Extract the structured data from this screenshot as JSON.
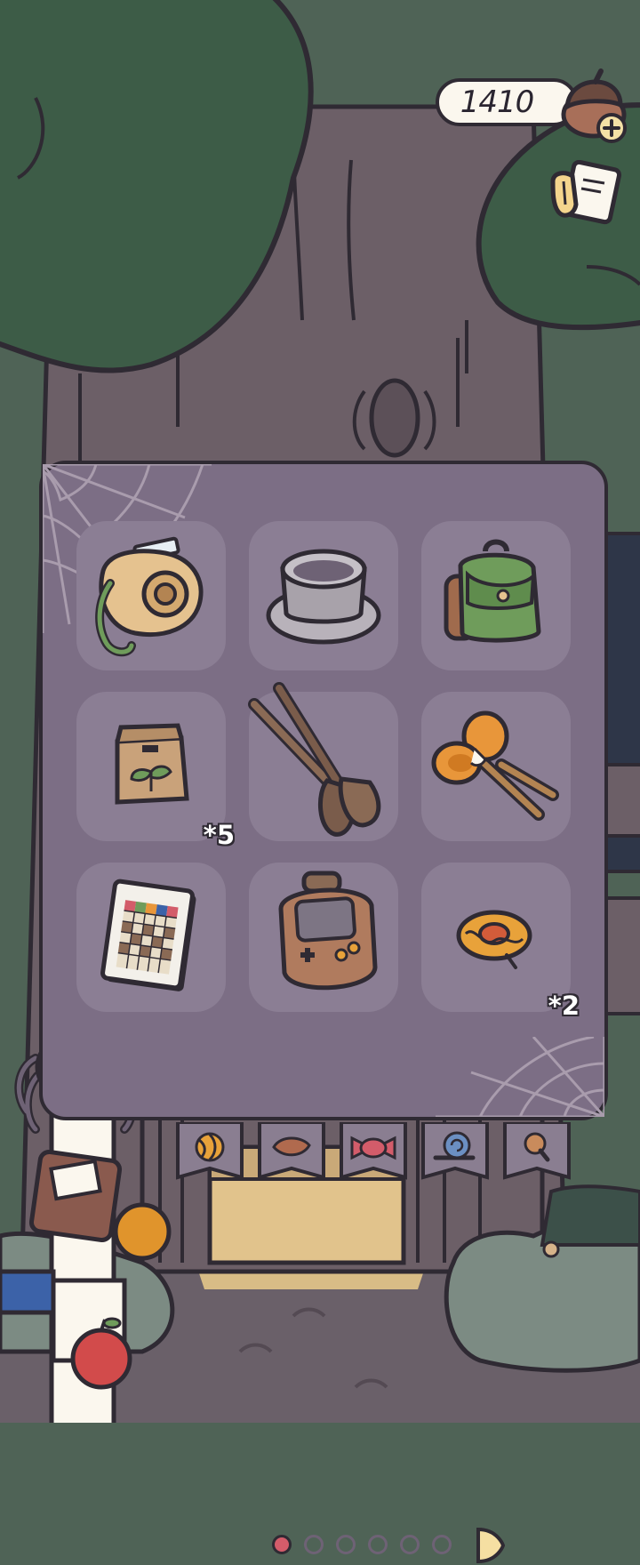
{
  "currency": {
    "amount": "1410",
    "icon": "acorn-plus-icon"
  },
  "header": {
    "note_icon": "hand-note-icon"
  },
  "inventory": {
    "items": [
      {
        "name": "instant-camera",
        "icon": "camera-icon",
        "count": ""
      },
      {
        "name": "teacup",
        "icon": "teacup-icon",
        "count": ""
      },
      {
        "name": "backpack",
        "icon": "backpack-icon",
        "count": ""
      },
      {
        "name": "seed-bag",
        "icon": "seed-bag-icon",
        "count": "*5"
      },
      {
        "name": "paddles",
        "icon": "paddles-icon",
        "count": ""
      },
      {
        "name": "pellet-drums",
        "icon": "rattle-drum-icon",
        "count": ""
      },
      {
        "name": "notebook",
        "icon": "notebook-icon",
        "count": ""
      },
      {
        "name": "handheld-console",
        "icon": "game-console-icon",
        "count": ""
      },
      {
        "name": "lollipop-candy",
        "icon": "candy-icon",
        "count": "*2"
      }
    ],
    "pagination": {
      "total_pages": 6,
      "current_page": 1
    }
  },
  "categories": [
    {
      "icon": "striped-ball-icon"
    },
    {
      "icon": "leaf-icon"
    },
    {
      "icon": "wrapped-candy-icon"
    },
    {
      "icon": "snail-icon"
    },
    {
      "icon": "magnifier-icon"
    }
  ],
  "colors": {
    "panel": "#7c6e85",
    "slot": "#8b7e94",
    "outline": "#2f2a33",
    "foliage": "#3d5c47",
    "active_dot": "#d35c6a"
  }
}
